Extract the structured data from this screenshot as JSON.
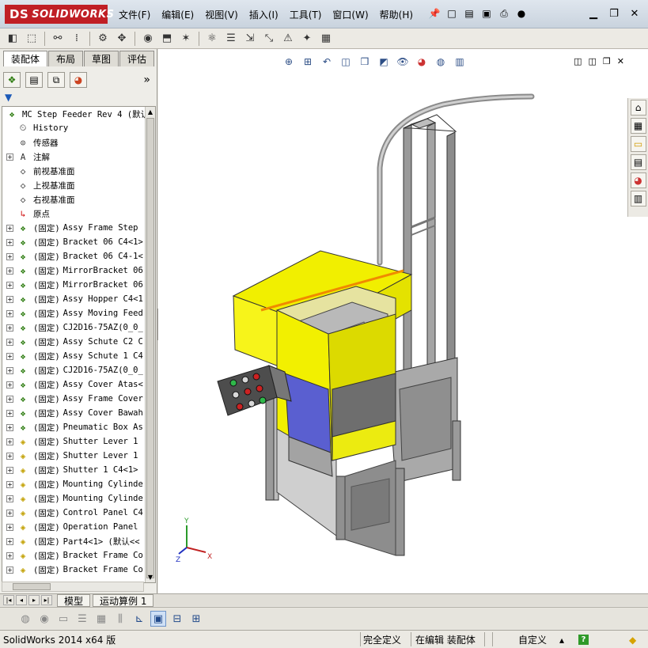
{
  "app": {
    "logo_prefix": "DS",
    "logo_text": "SOLIDWORKS",
    "menu": [
      "文件(F)",
      "编辑(E)",
      "视图(V)",
      "插入(I)",
      "工具(T)",
      "窗口(W)",
      "帮助(H)"
    ]
  },
  "left_panel": {
    "tabs": [
      "装配体",
      "布局",
      "草图",
      "评估"
    ],
    "active_tab": "装配体",
    "more_label": "»",
    "filter_label": "▼"
  },
  "tree": {
    "root": "MC Step Feeder Rev 4  (默认",
    "items": [
      {
        "label": "History",
        "icon": "history-icon",
        "expand": false
      },
      {
        "label": "传感器",
        "icon": "sensor-icon",
        "expand": false
      },
      {
        "label": "注解",
        "icon": "annotation-icon",
        "expand": true
      },
      {
        "label": "前视基准面",
        "icon": "plane-icon",
        "expand": false
      },
      {
        "label": "上视基准面",
        "icon": "plane-icon",
        "expand": false
      },
      {
        "label": "右视基准面",
        "icon": "plane-icon",
        "expand": false
      },
      {
        "label": "原点",
        "icon": "origin-icon",
        "expand": false
      }
    ],
    "components": [
      {
        "fixed": "(固定)",
        "name": "Assy Frame Step",
        "type": "asm"
      },
      {
        "fixed": "(固定)",
        "name": "Bracket 06 C4<1>",
        "type": "asm"
      },
      {
        "fixed": "(固定)",
        "name": "Bracket 06 C4-1<",
        "type": "asm"
      },
      {
        "fixed": "(固定)",
        "name": "MirrorBracket 06",
        "type": "asm"
      },
      {
        "fixed": "(固定)",
        "name": "MirrorBracket 06",
        "type": "asm"
      },
      {
        "fixed": "(固定)",
        "name": "Assy Hopper C4<1",
        "type": "asm"
      },
      {
        "fixed": "(固定)",
        "name": "Assy Moving Feed",
        "type": "asm"
      },
      {
        "fixed": "(固定)",
        "name": "CJ2D16-75AZ(0_0_",
        "type": "asm"
      },
      {
        "fixed": "(固定)",
        "name": "Assy Schute C2 C",
        "type": "asm"
      },
      {
        "fixed": "(固定)",
        "name": "Assy Schute 1 C4",
        "type": "asm"
      },
      {
        "fixed": "(固定)",
        "name": "CJ2D16-75AZ(0_0_",
        "type": "asm"
      },
      {
        "fixed": "(固定)",
        "name": "Assy Cover Atas<",
        "type": "asm"
      },
      {
        "fixed": "(固定)",
        "name": "Assy Frame Cover",
        "type": "asm"
      },
      {
        "fixed": "(固定)",
        "name": "Assy Cover Bawah",
        "type": "asm"
      },
      {
        "fixed": "(固定)",
        "name": "Pneumatic Box As",
        "type": "asm"
      },
      {
        "fixed": "(固定)",
        "name": "Shutter Lever 1",
        "type": "part"
      },
      {
        "fixed": "(固定)",
        "name": "Shutter Lever 1",
        "type": "part"
      },
      {
        "fixed": "(固定)",
        "name": "Shutter 1 C4<1>",
        "type": "part"
      },
      {
        "fixed": "(固定)",
        "name": "Mounting Cylinde",
        "type": "part"
      },
      {
        "fixed": "(固定)",
        "name": "Mounting Cylinde",
        "type": "part"
      },
      {
        "fixed": "(固定)",
        "name": "Control Panel C4",
        "type": "part"
      },
      {
        "fixed": "(固定)",
        "name": "Operation Panel",
        "type": "part"
      },
      {
        "fixed": "(固定)",
        "name": "Part4<1> (默认<<",
        "type": "part"
      },
      {
        "fixed": "(固定)",
        "name": "Bracket Frame Co",
        "type": "part"
      },
      {
        "fixed": "(固定)",
        "name": "Bracket Frame Co",
        "type": "part"
      }
    ]
  },
  "bottom_tabs": [
    "模型",
    "运动算例 1"
  ],
  "status": {
    "left": "SolidWorks 2014 x64 版",
    "under_defined": "完全定义",
    "editing": "在编辑 装配体",
    "units": "自定义",
    "help": "?"
  },
  "triad": {
    "x": "X",
    "y": "Y",
    "z": "Z"
  },
  "colors": {
    "accent": "#c01f25",
    "yellow_panel": "#f2f000",
    "frame": "#8e8e8e",
    "blue_plate": "#5a62c8"
  }
}
